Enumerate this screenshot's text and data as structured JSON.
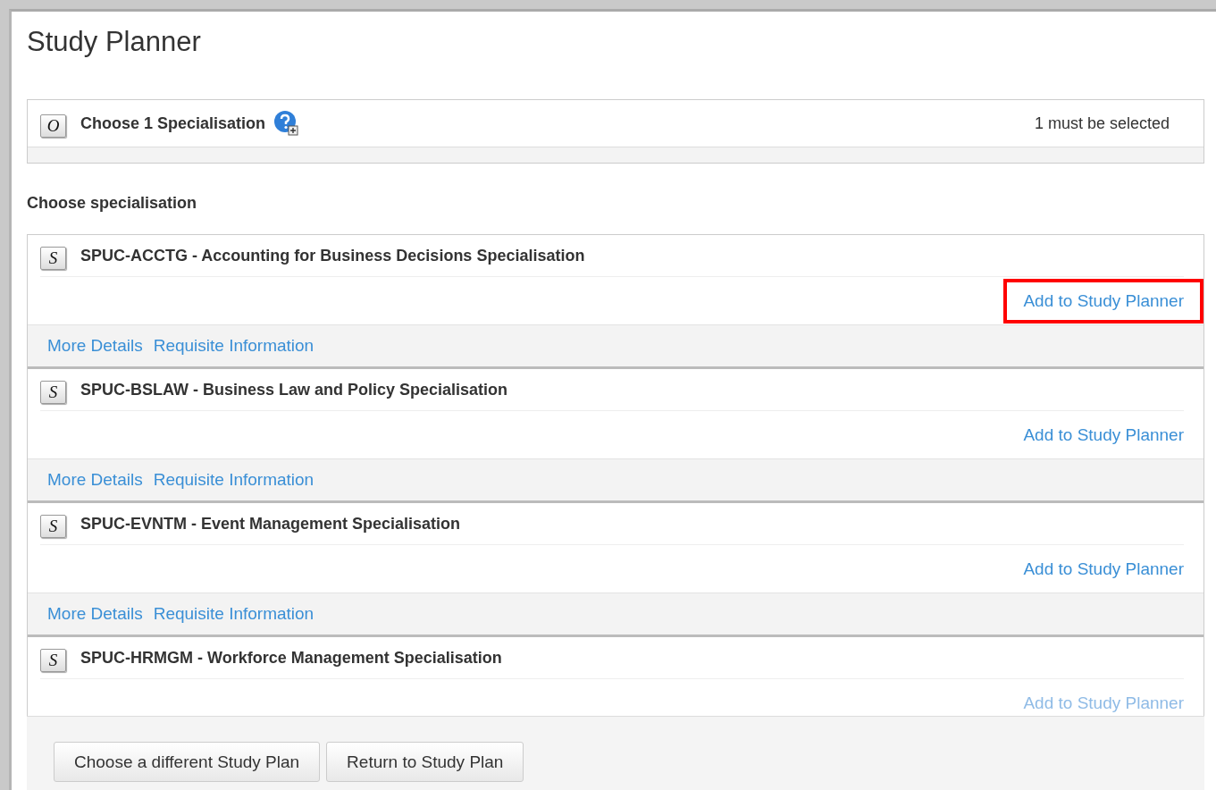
{
  "title": "Study Planner",
  "rule": {
    "badge": "O",
    "label": "Choose 1 Specialisation",
    "status": "1 must be selected"
  },
  "section_heading": "Choose specialisation",
  "specialisations": [
    {
      "badge": "S",
      "title": "SPUC-ACCTG - Accounting for Business Decisions Specialisation",
      "action": "Add to Study Planner",
      "highlighted": true,
      "faded": false,
      "links": [
        "More Details",
        "Requisite Information"
      ]
    },
    {
      "badge": "S",
      "title": "SPUC-BSLAW - Business Law and Policy Specialisation",
      "action": "Add to Study Planner",
      "highlighted": false,
      "faded": false,
      "links": [
        "More Details",
        "Requisite Information"
      ]
    },
    {
      "badge": "S",
      "title": "SPUC-EVNTM - Event Management Specialisation",
      "action": "Add to Study Planner",
      "highlighted": false,
      "faded": false,
      "links": [
        "More Details",
        "Requisite Information"
      ]
    },
    {
      "badge": "S",
      "title": "SPUC-HRMGM - Workforce Management Specialisation",
      "action": "Add to Study Planner",
      "highlighted": false,
      "faded": true
    }
  ],
  "buttons": [
    "Choose a different Study Plan",
    "Return to Study Plan"
  ]
}
